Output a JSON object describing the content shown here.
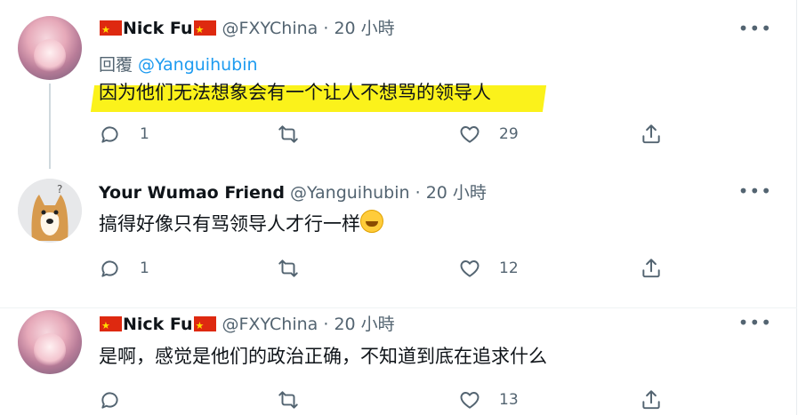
{
  "tweets": [
    {
      "author": "Nick Fu",
      "handle": "@FXYChina",
      "time": "20 小時",
      "reply_prefix": "回覆",
      "reply_to": "@Yanguihubin",
      "text": "因为他们无法想象会有一个让人不想骂的领导人",
      "reply_count": "1",
      "retweet_count": "",
      "like_count": "29"
    },
    {
      "author": "Your Wumao Friend",
      "handle": "@Yanguihubin",
      "time": "20 小時",
      "text": "搞得好像只有骂领导人才行一样",
      "reply_count": "1",
      "retweet_count": "",
      "like_count": "12"
    },
    {
      "author": "Nick Fu",
      "handle": "@FXYChina",
      "time": "20 小時",
      "text": "是啊，感觉是他们的政治正确，不知道到底在追求什么",
      "reply_count": "",
      "retweet_count": "",
      "like_count": "13"
    }
  ],
  "meta_separator": "·",
  "more_glyph": "•••",
  "colors": {
    "highlight": "#fbf21b",
    "link": "#1d9bf0",
    "muted": "#536471"
  },
  "icons": [
    "reply-icon",
    "retweet-icon",
    "like-icon",
    "share-icon",
    "more-icon",
    "china-flag-icon",
    "grinning-sweat-emoji"
  ]
}
